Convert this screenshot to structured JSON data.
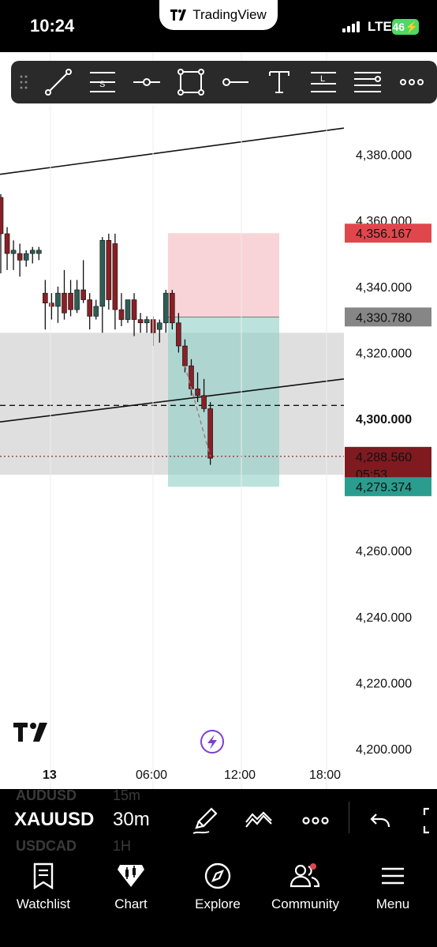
{
  "status_bar": {
    "time": "10:24",
    "app": "TradingView",
    "network": "LTE",
    "battery": "46"
  },
  "drawing_toolbar": {
    "tools": [
      "trend-line",
      "fib-retracement",
      "horizontal-ray",
      "rectangle",
      "horizontal-line",
      "text",
      "long-position",
      "parallel-channel",
      "more"
    ]
  },
  "price_axis": {
    "levels": [
      "4,380.000",
      "4,360.000",
      "4,340.000",
      "4,320.000",
      "4,300.000",
      "4,260.000",
      "4,240.000",
      "4,220.000",
      "4,200.000"
    ],
    "bold_level": "4,300.000",
    "tags": {
      "stop": {
        "value": "4,356.167",
        "color": "#e0474c"
      },
      "entry": {
        "value": "4,330.780",
        "color": "#868686"
      },
      "current": {
        "value": "4,288.560",
        "countdown": "05:53",
        "color": "#7e1a20"
      },
      "target": {
        "value": "4,279.374",
        "color": "#2a9d8f"
      }
    }
  },
  "time_axis": {
    "labels": [
      "13",
      "06:00",
      "12:00",
      "18:00"
    ]
  },
  "chart_data": {
    "type": "candlestick",
    "interval": "30m",
    "symbol": "XAUUSD",
    "y_range": [
      4200,
      4390
    ],
    "candles": [
      {
        "o": 4367,
        "h": 4368,
        "l": 4344,
        "c": 4356
      },
      {
        "o": 4356,
        "h": 4358,
        "l": 4345,
        "c": 4350
      },
      {
        "o": 4350,
        "h": 4354,
        "l": 4345,
        "c": 4351
      },
      {
        "o": 4350,
        "h": 4353,
        "l": 4343,
        "c": 4348
      },
      {
        "o": 4348,
        "h": 4351,
        "l": 4346,
        "c": 4350
      },
      {
        "o": 4350,
        "h": 4352,
        "l": 4347,
        "c": 4351
      },
      {
        "o": 4350,
        "h": 4352,
        "l": 4348,
        "c": 4351
      },
      {
        "o": 4338,
        "h": 4342,
        "l": 4327,
        "c": 4335
      },
      {
        "o": 4335,
        "h": 4338,
        "l": 4330,
        "c": 4334
      },
      {
        "o": 4334,
        "h": 4340,
        "l": 4329,
        "c": 4338
      },
      {
        "o": 4338,
        "h": 4345,
        "l": 4330,
        "c": 4332
      },
      {
        "o": 4338,
        "h": 4342,
        "l": 4331,
        "c": 4333
      },
      {
        "o": 4333,
        "h": 4342,
        "l": 4332,
        "c": 4339
      },
      {
        "o": 4339,
        "h": 4348,
        "l": 4335,
        "c": 4336
      },
      {
        "o": 4336,
        "h": 4338,
        "l": 4327,
        "c": 4331
      },
      {
        "o": 4331,
        "h": 4336,
        "l": 4330,
        "c": 4334
      },
      {
        "o": 4334,
        "h": 4355,
        "l": 4326,
        "c": 4354
      },
      {
        "o": 4354,
        "h": 4356,
        "l": 4333,
        "c": 4336
      },
      {
        "o": 4353,
        "h": 4356,
        "l": 4327,
        "c": 4333
      },
      {
        "o": 4333,
        "h": 4338,
        "l": 4328,
        "c": 4330
      },
      {
        "o": 4330,
        "h": 4336,
        "l": 4329,
        "c": 4336
      },
      {
        "o": 4336,
        "h": 4338,
        "l": 4325,
        "c": 4330
      },
      {
        "o": 4330,
        "h": 4332,
        "l": 4326,
        "c": 4329
      },
      {
        "o": 4329,
        "h": 4331,
        "l": 4326,
        "c": 4330
      },
      {
        "o": 4330,
        "h": 4331,
        "l": 4322,
        "c": 4326
      },
      {
        "o": 4327,
        "h": 4330,
        "l": 4323,
        "c": 4329
      },
      {
        "o": 4329,
        "h": 4339,
        "l": 4326,
        "c": 4338
      },
      {
        "o": 4338,
        "h": 4339,
        "l": 4327,
        "c": 4329
      },
      {
        "o": 4329,
        "h": 4332,
        "l": 4320,
        "c": 4322
      },
      {
        "o": 4322,
        "h": 4324,
        "l": 4314,
        "c": 4316
      },
      {
        "o": 4316,
        "h": 4318,
        "l": 4307,
        "c": 4309
      },
      {
        "o": 4309,
        "h": 4314,
        "l": 4305,
        "c": 4307
      },
      {
        "o": 4307,
        "h": 4312,
        "l": 4302,
        "c": 4303
      },
      {
        "o": 4303,
        "h": 4305,
        "l": 4286,
        "c": 4288
      }
    ],
    "lines": [
      {
        "from": [
          0,
          4374
        ],
        "to": [
          60,
          4388
        ]
      },
      {
        "from": [
          0,
          4299
        ],
        "to": [
          60,
          4312
        ]
      }
    ],
    "dashed_level": 4304,
    "support_zone": [
      4283,
      4326
    ],
    "position": {
      "type": "short",
      "entry": 4330.78,
      "stop": 4356.167,
      "target": 4279.374
    },
    "current_price": 4288.56
  },
  "controls": {
    "symbol": "XAUUSD",
    "symbol_prev": "AUDUSD",
    "symbol_next": "USDCAD",
    "timeframe": "30m",
    "timeframe_prev": "15m",
    "timeframe_next": "1H"
  },
  "nav": {
    "watchlist": "Watchlist",
    "chart": "Chart",
    "explore": "Explore",
    "community": "Community",
    "menu": "Menu"
  }
}
